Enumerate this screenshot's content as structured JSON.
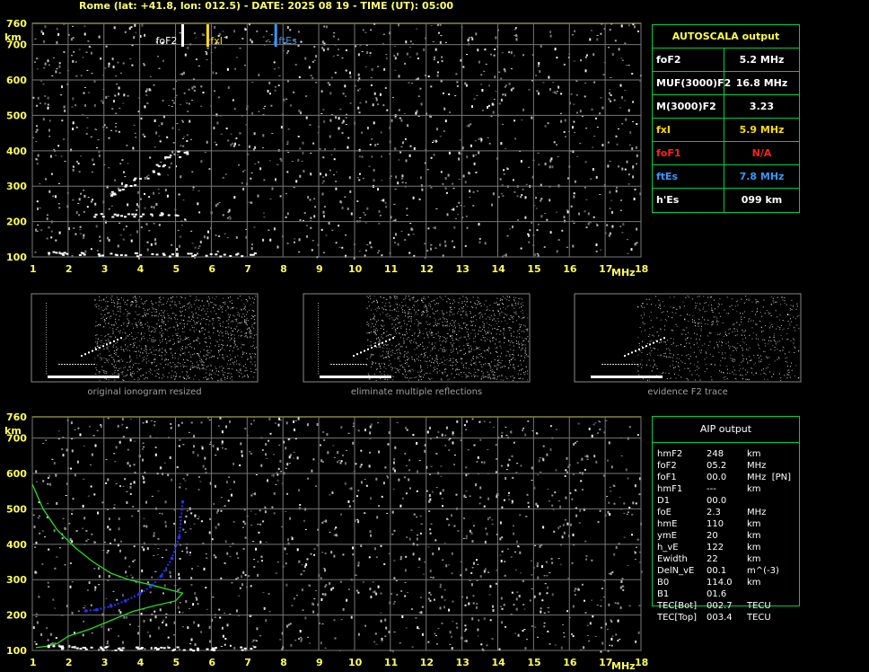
{
  "header": {
    "title": "Rome (lat: +41.8, lon: 012.5) - DATE: 2025 08 19 - TIME (UT): 05:00"
  },
  "autoscala": {
    "title": "AUTOSCALA output",
    "rows": [
      {
        "key": "foF2",
        "value": "5.2 MHz",
        "color": "#ffffff"
      },
      {
        "key": "MUF(3000)F2",
        "value": "16.8 MHz",
        "color": "#ffffff"
      },
      {
        "key": "M(3000)F2",
        "value": "3.23",
        "color": "#ffffff"
      },
      {
        "key": "fxI",
        "value": "5.9 MHz",
        "color": "#ffdd00"
      },
      {
        "key": "foF1",
        "value": "N/A",
        "color": "#ff2020"
      },
      {
        "key": "ftEs",
        "value": "7.8 MHz",
        "color": "#3399ff"
      },
      {
        "key": "h'Es",
        "value": "099    km",
        "color": "#ffffff"
      }
    ]
  },
  "aip": {
    "title": "AIP output",
    "rows": [
      {
        "param": "hmF2",
        "value": "248",
        "unit": "km"
      },
      {
        "param": "foF2",
        "value": "05.2",
        "unit": "MHz"
      },
      {
        "param": "foF1",
        "value": "00.0",
        "unit": "MHz  [PN]"
      },
      {
        "param": "hmF1",
        "value": "---",
        "unit": "km"
      },
      {
        "param": "D1",
        "value": "00.0",
        "unit": ""
      },
      {
        "param": "foE",
        "value": "2.3",
        "unit": "MHz"
      },
      {
        "param": "hmE",
        "value": "110",
        "unit": "km"
      },
      {
        "param": "ymE",
        "value": "20",
        "unit": "km"
      },
      {
        "param": "h_vE",
        "value": "122",
        "unit": "km"
      },
      {
        "param": "Ewidth",
        "value": "22",
        "unit": "km"
      },
      {
        "param": "DelN_vE",
        "value": "00.1",
        "unit": "m^(-3)"
      },
      {
        "param": "B0",
        "value": "114.0",
        "unit": "km"
      },
      {
        "param": "B1",
        "value": "01.6",
        "unit": ""
      },
      {
        "param": "TEC[Bot]",
        "value": "002.7",
        "unit": "TECU"
      },
      {
        "param": "TEC[Top]",
        "value": "003.4",
        "unit": "TECU"
      }
    ]
  },
  "captions": [
    "original ionogram resized",
    "eliminate multiple reflections",
    "evidence F2 trace"
  ],
  "chart_data": [
    {
      "type": "scatter",
      "title": "",
      "xlabel": "MHz",
      "ylabel": "km",
      "xlim": [
        1,
        18
      ],
      "ylim": [
        100,
        760
      ],
      "xticks": [
        1,
        2,
        3,
        4,
        5,
        6,
        7,
        8,
        9,
        10,
        11,
        12,
        13,
        14,
        15,
        16,
        17,
        18
      ],
      "yticks": [
        100,
        200,
        300,
        400,
        500,
        600,
        700,
        760
      ],
      "grid": true,
      "markers": [
        {
          "label": "foF2",
          "x": 5.2,
          "color": "#ffffff"
        },
        {
          "label": "fxI",
          "x": 5.9,
          "color": "#ffdd00"
        },
        {
          "label": "ftEs",
          "x": 7.8,
          "color": "#3399ff"
        }
      ],
      "series": [
        {
          "points": [
            [
              1.6,
              115
            ],
            [
              2.0,
              112
            ],
            [
              2.5,
              110
            ],
            [
              3.0,
              109
            ],
            [
              3.5,
              108
            ],
            [
              4.0,
              108
            ],
            [
              4.5,
              108
            ],
            [
              5.0,
              108
            ],
            [
              5.5,
              108
            ],
            [
              6.0,
              108
            ],
            [
              6.5,
              108
            ],
            [
              7.0,
              108
            ]
          ]
        },
        {
          "points": [
            [
              2.8,
              220
            ],
            [
              3.2,
              220
            ],
            [
              3.6,
              221
            ],
            [
              4.0,
              221
            ],
            [
              4.4,
              222
            ],
            [
              4.8,
              222
            ]
          ]
        },
        {
          "points": [
            [
              3.1,
              280
            ],
            [
              3.4,
              290
            ],
            [
              3.7,
              305
            ],
            [
              4.0,
              320
            ],
            [
              4.3,
              340
            ],
            [
              4.6,
              360
            ],
            [
              4.9,
              380
            ],
            [
              5.1,
              395
            ]
          ]
        }
      ]
    },
    {
      "type": "line",
      "title": "",
      "xlabel": "MHz",
      "ylabel": "km",
      "xlim": [
        1,
        18
      ],
      "ylim": [
        100,
        760
      ],
      "xticks": [
        1,
        2,
        3,
        4,
        5,
        6,
        7,
        8,
        9,
        10,
        11,
        12,
        13,
        14,
        15,
        16,
        17,
        18
      ],
      "yticks": [
        100,
        200,
        300,
        400,
        500,
        600,
        700,
        760
      ],
      "grid": true,
      "series": [
        {
          "color": "#22dd22",
          "points": [
            [
              1.0,
              570
            ],
            [
              1.3,
              500
            ],
            [
              1.7,
              440
            ],
            [
              2.2,
              390
            ],
            [
              2.7,
              350
            ],
            [
              3.2,
              318
            ],
            [
              3.7,
              300
            ],
            [
              4.2,
              288
            ],
            [
              4.7,
              275
            ],
            [
              5.2,
              262
            ],
            [
              5.0,
              240
            ],
            [
              4.4,
              226
            ],
            [
              3.8,
              210
            ],
            [
              3.2,
              185
            ],
            [
              2.6,
              160
            ],
            [
              2.0,
              140
            ],
            [
              1.7,
              120
            ],
            [
              1.4,
              112
            ],
            [
              1.1,
              108
            ]
          ]
        },
        {
          "color": "#2233ff",
          "points": [
            [
              2.5,
              212
            ],
            [
              2.8,
              215
            ],
            [
              3.2,
              225
            ],
            [
              3.6,
              240
            ],
            [
              4.0,
              260
            ],
            [
              4.3,
              280
            ],
            [
              4.6,
              310
            ],
            [
              4.9,
              360
            ],
            [
              5.1,
              420
            ],
            [
              5.2,
              520
            ]
          ]
        },
        {
          "color": "#ffffff",
          "points": [
            [
              1.6,
              113
            ],
            [
              2.0,
              110
            ],
            [
              2.5,
              108
            ],
            [
              3.0,
              108
            ],
            [
              3.5,
              107
            ],
            [
              4.0,
              107
            ],
            [
              4.5,
              107
            ],
            [
              5.0,
              107
            ],
            [
              5.5,
              107
            ],
            [
              6.0,
              107
            ],
            [
              7.0,
              107
            ]
          ]
        }
      ]
    }
  ]
}
